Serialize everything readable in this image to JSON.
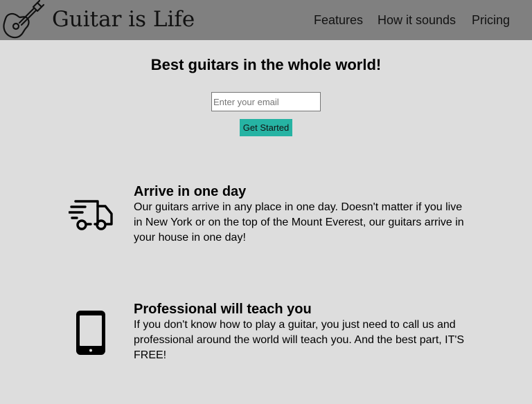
{
  "header": {
    "brand": "Guitar is Life",
    "logo_icon": "guitar-icon",
    "nav": [
      "Features",
      "How it sounds",
      "Pricing"
    ]
  },
  "hero": {
    "title": "Best guitars in the whole world!",
    "email_placeholder": "Enter your email",
    "cta_label": "Get Started",
    "cta_color": "#26b3a3"
  },
  "features": [
    {
      "icon": "shipping-truck-icon",
      "title": "Arrive in one day",
      "text": "Our guitars arrive in any place in one day. Doesn't matter if you live in New York or on the top of the Mount Everest, our guitars arrive in your house in one day!"
    },
    {
      "icon": "mobile-phone-icon",
      "title": "Professional will teach you",
      "text": "If you don't know how to play a guitar, you just need to call us and professional around the world will teach you. And the best part, IT'S FREE!"
    }
  ],
  "colors": {
    "header_bg": "#808080",
    "page_bg": "#dddddd"
  }
}
